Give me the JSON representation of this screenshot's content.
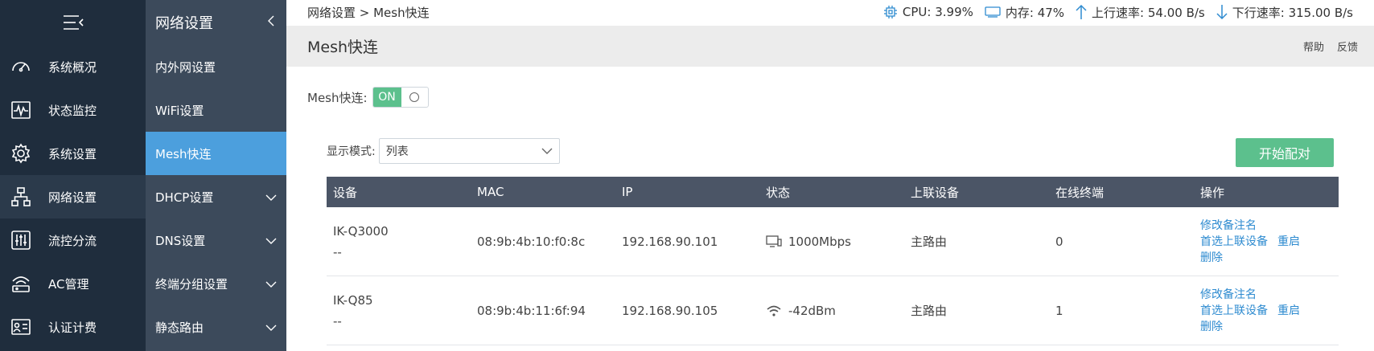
{
  "sidebar": {
    "items": [
      {
        "label": "系统概况",
        "icon": "dashboard-icon"
      },
      {
        "label": "状态监控",
        "icon": "monitor-icon"
      },
      {
        "label": "系统设置",
        "icon": "gear-icon"
      },
      {
        "label": "网络设置",
        "icon": "network-icon"
      },
      {
        "label": "流控分流",
        "icon": "sliders-icon"
      },
      {
        "label": "AC管理",
        "icon": "wireless-ap-icon"
      },
      {
        "label": "认证计费",
        "icon": "id-card-icon"
      }
    ]
  },
  "subnav": {
    "title": "网络设置",
    "items": [
      {
        "label": "内外网设置"
      },
      {
        "label": "WiFi设置"
      },
      {
        "label": "Mesh快连"
      },
      {
        "label": "DHCP设置"
      },
      {
        "label": "DNS设置"
      },
      {
        "label": "终端分组设置"
      },
      {
        "label": "静态路由"
      }
    ]
  },
  "topbar": {
    "breadcrumb": "网络设置 > Mesh快连",
    "cpu": "CPU: 3.99%",
    "memory": "内存: 47%",
    "upload": "上行速率: 54.00 B/s",
    "download": "下行速率: 315.00 B/s"
  },
  "header": {
    "title": "Mesh快连",
    "help": "帮助",
    "feedback": "反馈"
  },
  "mesh": {
    "label": "Mesh快连:",
    "toggle_on": "ON"
  },
  "mode": {
    "label": "显示模式:",
    "value": "列表"
  },
  "pair_button": "开始配对",
  "table": {
    "headers": [
      "设备",
      "MAC",
      "IP",
      "状态",
      "上联设备",
      "在线终端",
      "操作"
    ],
    "rows": [
      {
        "name": "IK-Q3000",
        "remark": "--",
        "mac": "08:9b:4b:10:f0:8c",
        "ip": "192.168.90.101",
        "status_icon": "wired-icon",
        "status": "1000Mbps",
        "uplink": "主路由",
        "clients": "0"
      },
      {
        "name": "IK-Q85",
        "remark": "--",
        "mac": "08:9b:4b:11:6f:94",
        "ip": "192.168.90.105",
        "status_icon": "wifi-icon",
        "status": "-42dBm",
        "uplink": "主路由",
        "clients": "1"
      }
    ],
    "ops": {
      "edit_remark": "修改备注名",
      "prefer_uplink": "首选上联设备",
      "restart": "重启",
      "delete": "删除"
    }
  }
}
